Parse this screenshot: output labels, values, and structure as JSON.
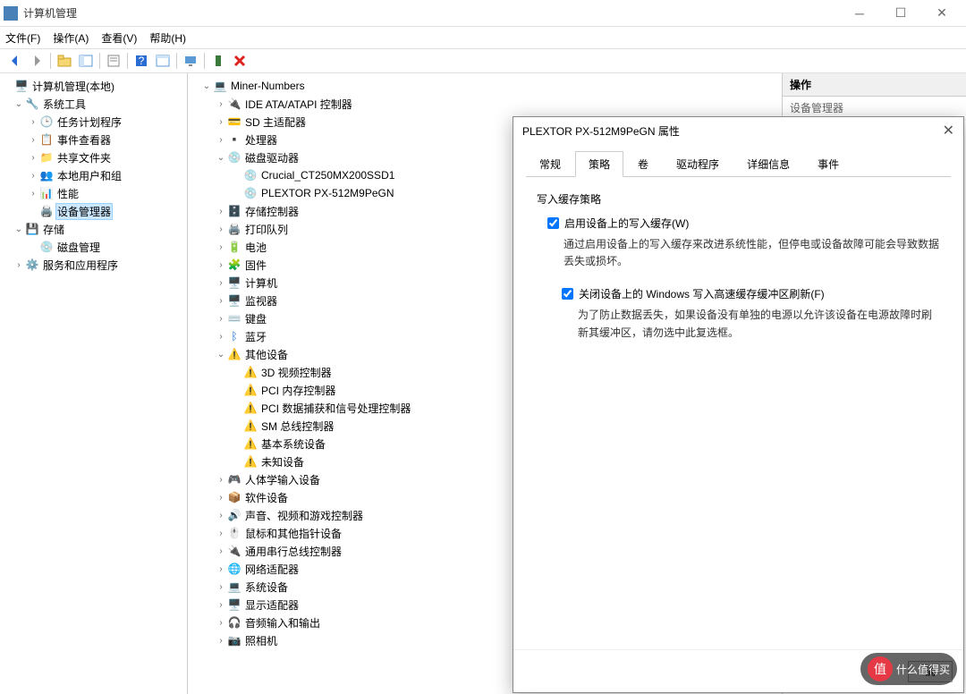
{
  "window": {
    "title": "计算机管理"
  },
  "menu": {
    "file": "文件(F)",
    "action": "操作(A)",
    "view": "查看(V)",
    "help": "帮助(H)"
  },
  "leftTree": {
    "root": "计算机管理(本地)",
    "systools": "系统工具",
    "scheduler": "任务计划程序",
    "eventviewer": "事件查看器",
    "shared": "共享文件夹",
    "localusers": "本地用户和组",
    "perf": "性能",
    "devmgr": "设备管理器",
    "storage": "存储",
    "diskmgmt": "磁盘管理",
    "services": "服务和应用程序"
  },
  "midTree": {
    "root": "Miner-Numbers",
    "ide": "IDE ATA/ATAPI 控制器",
    "sd": "SD 主适配器",
    "cpu": "处理器",
    "diskdrv": "磁盘驱动器",
    "crucial": "Crucial_CT250MX200SSD1",
    "plextor": "PLEXTOR PX-512M9PeGN",
    "storctrl": "存储控制器",
    "printq": "打印队列",
    "battery": "电池",
    "firmware": "固件",
    "computer": "计算机",
    "monitor": "监视器",
    "keyboard": "键盘",
    "bluetooth": "蓝牙",
    "otherdev": "其他设备",
    "vid3d": "3D 视频控制器",
    "pcimem": "PCI 内存控制器",
    "pcidata": "PCI 数据捕获和信号处理控制器",
    "smbus": "SM 总线控制器",
    "basesys": "基本系统设备",
    "unknown": "未知设备",
    "hid": "人体学输入设备",
    "soft": "软件设备",
    "sound": "声音、视频和游戏控制器",
    "mouse": "鼠标和其他指针设备",
    "usb": "通用串行总线控制器",
    "net": "网络适配器",
    "sysdev": "系统设备",
    "display": "显示适配器",
    "audio": "音频输入和输出",
    "camera": "照相机"
  },
  "rightPane": {
    "header": "操作",
    "sub": "设备管理器"
  },
  "dialog": {
    "title": "PLEXTOR PX-512M9PeGN 属性",
    "tabs": {
      "general": "常规",
      "policy": "策略",
      "volumes": "卷",
      "driver": "驱动程序",
      "details": "详细信息",
      "events": "事件"
    },
    "groupLabel": "写入缓存策略",
    "check1": "启用设备上的写入缓存(W)",
    "desc1": "通过启用设备上的写入缓存来改进系统性能，但停电或设备故障可能会导致数据丢失或损坏。",
    "check2": "关闭设备上的 Windows 写入高速缓存缓冲区刷新(F)",
    "desc2": "为了防止数据丢失，如果设备没有单独的电源以允许该设备在电源故障时刷新其缓冲区，请勿选中此复选框。",
    "btn": "确"
  },
  "watermark": {
    "circle": "值",
    "text": "什么值得买"
  }
}
